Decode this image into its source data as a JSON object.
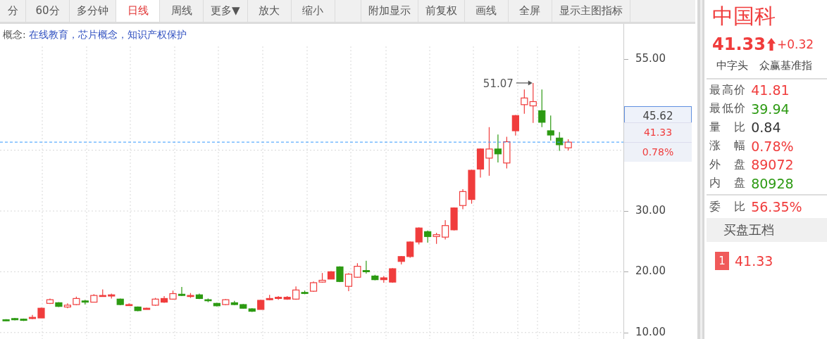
{
  "toolbar": {
    "tabs": [
      {
        "label": "分",
        "selected": false
      },
      {
        "label": "60分",
        "selected": false
      },
      {
        "label": "多分钟",
        "selected": false
      },
      {
        "label": "日线",
        "selected": true
      },
      {
        "label": "周线",
        "selected": false
      },
      {
        "label": "更多▼",
        "selected": false
      },
      {
        "label": "放大",
        "selected": false
      },
      {
        "label": "缩小",
        "selected": false
      },
      {
        "label": "附加显示",
        "selected": false
      },
      {
        "label": "前复权",
        "selected": false
      },
      {
        "label": "画线",
        "selected": false
      },
      {
        "label": "全屏",
        "selected": false
      },
      {
        "label": "显示主图指标",
        "selected": false
      }
    ]
  },
  "concepts": {
    "label": "概念:",
    "value": "在线教育，芯片概念，知识产权保护"
  },
  "chart": {
    "high_label": "51.07",
    "y_axis_labels": [
      "55.00",
      "30.00",
      "20.00",
      "10.00"
    ],
    "cursor_price": "45.62",
    "last_price": "41.33",
    "last_change": "0.78%"
  },
  "quote": {
    "name": "中国科",
    "price": "41.33",
    "change": "+0.32",
    "tags": [
      "中字头",
      "众赢基准指"
    ],
    "stats": [
      {
        "label": "最高价",
        "value": "41.81",
        "color": "#f03c3c"
      },
      {
        "label": "最低价",
        "value": "39.94",
        "color": "#2c9a12"
      },
      {
        "label": "量 比",
        "value": "0.84",
        "color": "#333333"
      },
      {
        "label": "涨 幅",
        "value": "0.78%",
        "color": "#f03c3c"
      },
      {
        "label": "外 盘",
        "value": "89072",
        "color": "#f03c3c"
      },
      {
        "label": "内 盘",
        "value": "80928",
        "color": "#2c9a12"
      }
    ],
    "ratio": {
      "label": "委 比",
      "value": "56.35%",
      "color": "#f03c3c"
    },
    "order_book": {
      "title": "买盘五档",
      "levels": [
        {
          "index": "1",
          "price": "41.33"
        }
      ]
    }
  }
}
